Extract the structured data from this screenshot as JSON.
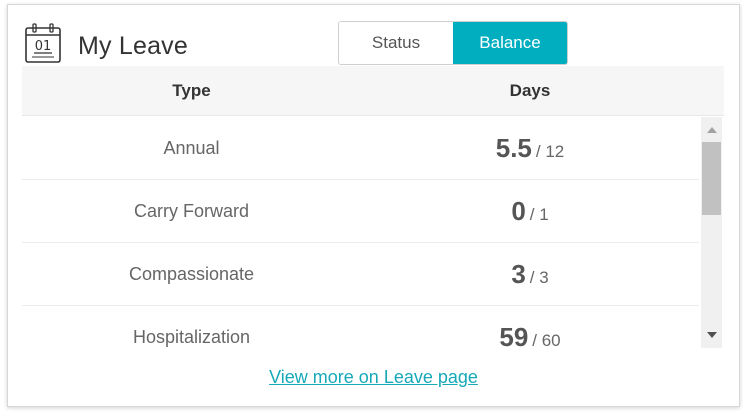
{
  "widget": {
    "title": "My Leave",
    "icon_text": "01",
    "icon": "calendar-icon"
  },
  "toggle": {
    "options": [
      "Status",
      "Balance"
    ],
    "selected": "Balance",
    "accent_color": "#00aebf"
  },
  "table": {
    "headers": {
      "type": "Type",
      "days": "Days"
    },
    "rows": [
      {
        "type": "Annual",
        "used": "5.5",
        "total": "/ 12"
      },
      {
        "type": "Carry Forward",
        "used": "0",
        "total": "/ 1"
      },
      {
        "type": "Compassionate",
        "used": "3",
        "total": "/ 3"
      },
      {
        "type": "Hospitalization",
        "used": "59",
        "total": "/ 60"
      }
    ]
  },
  "footer": {
    "link_text": "View more on Leave page",
    "link_color": "#17a9b8"
  }
}
